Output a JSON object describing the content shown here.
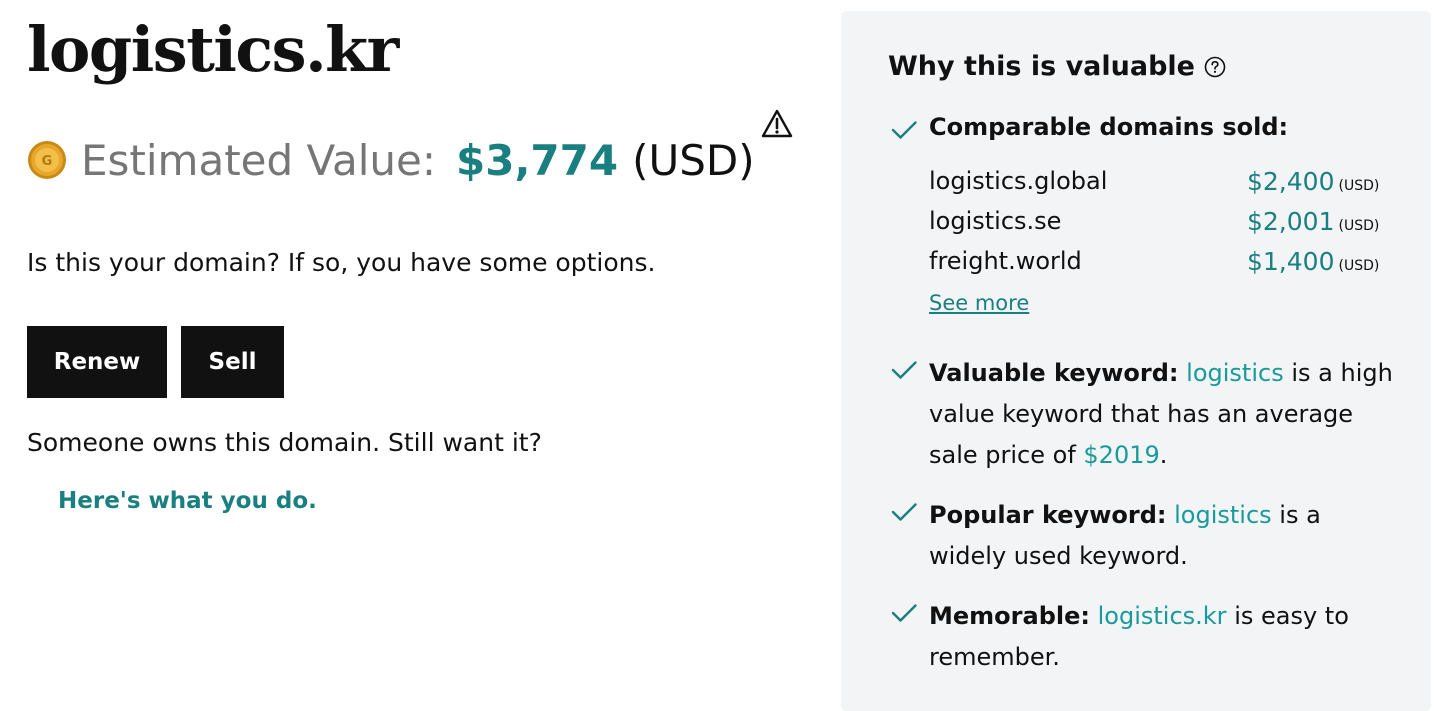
{
  "domain": {
    "name": "logistics.kr"
  },
  "valuation": {
    "label": "Estimated Value:",
    "amount": "$3,774",
    "currency": "(USD)",
    "coin_letter": "G"
  },
  "owner_prompt": {
    "question": "Is this your domain? If so, you have some options.",
    "renew_label": "Renew",
    "sell_label": "Sell",
    "owned_text": "Someone owns this domain. Still want it?",
    "howto_link": "Here's what you do."
  },
  "panel": {
    "title": "Why this is valuable",
    "comparable": {
      "heading": "Comparable domains sold:",
      "rows": [
        {
          "name": "logistics.global",
          "price": "$2,400",
          "currency": "(USD)"
        },
        {
          "name": "logistics.se",
          "price": "$2,001",
          "currency": "(USD)"
        },
        {
          "name": "freight.world",
          "price": "$1,400",
          "currency": "(USD)"
        }
      ],
      "see_more": "See more"
    },
    "valuable_keyword": {
      "label": "Valuable keyword:",
      "keyword": "logistics",
      "text_before_price": "is a high value keyword that has an average sale price of",
      "price": "$2019",
      "text_after_price": "."
    },
    "popular_keyword": {
      "label": "Popular keyword:",
      "keyword": "logistics",
      "text": "is a widely used keyword."
    },
    "memorable": {
      "label": "Memorable:",
      "domain": "logistics.kr",
      "text": "is easy to remember."
    }
  },
  "colors": {
    "teal_dark": "#1a7f80",
    "teal_link": "#1a9a9a",
    "panel_bg": "#f3f4f6",
    "button_bg": "#111111",
    "coin_gold": "#e0a020"
  },
  "icons": {
    "coin": "coin-icon",
    "warning": "warning-triangle-icon",
    "help": "question-circle-icon",
    "check": "check-icon"
  }
}
